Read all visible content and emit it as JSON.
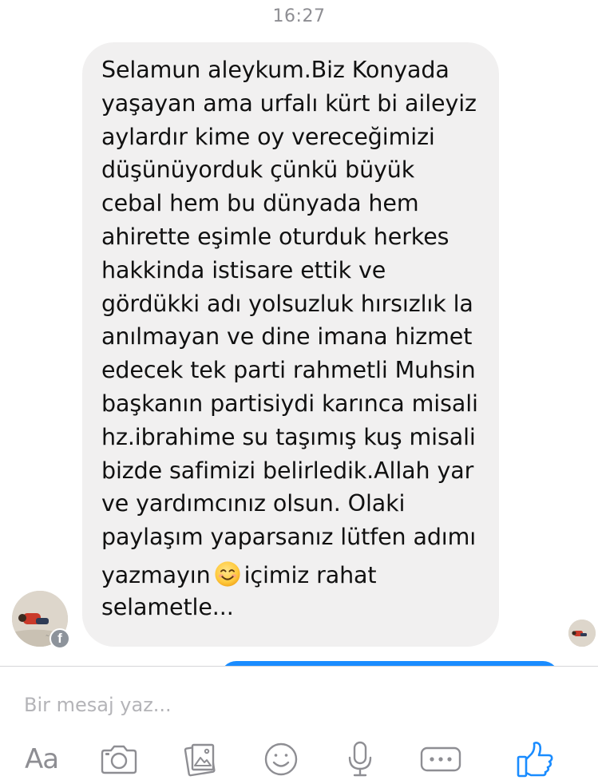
{
  "conversation": {
    "timestamp": "16:27",
    "message": {
      "lines_top": [
        "Selamun aleykum.Biz Konyada",
        "yaşayan ama urfalı kürt bi aileyiz",
        "aylardır kime oy vereceğimizi",
        "düşünüyorduk çünkü büyük",
        "cebal hem bu dünyada hem",
        "ahirette eşimle oturduk herkes",
        "hakkinda istisare ettik ve",
        "gördükki adı yolsuzluk hırsızlık la",
        "anılmayan ve dine imana hizmet",
        "edecek tek parti rahmetli Muhsin",
        "başkanın partisiydi karınca misali",
        "hz.ibrahime su taşımış kuş misali",
        "bizde safimizi belirledik.Allah yar",
        "ve yardımcınız olsun. Olaki",
        "paylaşım yaparsanız lütfen adımı"
      ],
      "emoji_line_before": "yazmayın",
      "emoji_line_after": "içimiz rahat",
      "last_line": "selametle..."
    },
    "emoji_icon": "smiling-face-emoji",
    "sender_badge_letter": "f"
  },
  "composer": {
    "placeholder": "Bir mesaj yaz...",
    "value": ""
  },
  "toolbar": {
    "text_button": "Aa",
    "icons": [
      "camera-icon",
      "gallery-icon",
      "emoji-icon",
      "microphone-icon",
      "more-icon",
      "like-icon"
    ]
  },
  "colors": {
    "bubble_background": "#f1f0f0",
    "accent_blue": "#1a8cff",
    "icon_gray": "#8e8e93",
    "timestamp_gray": "#8e8e93"
  }
}
